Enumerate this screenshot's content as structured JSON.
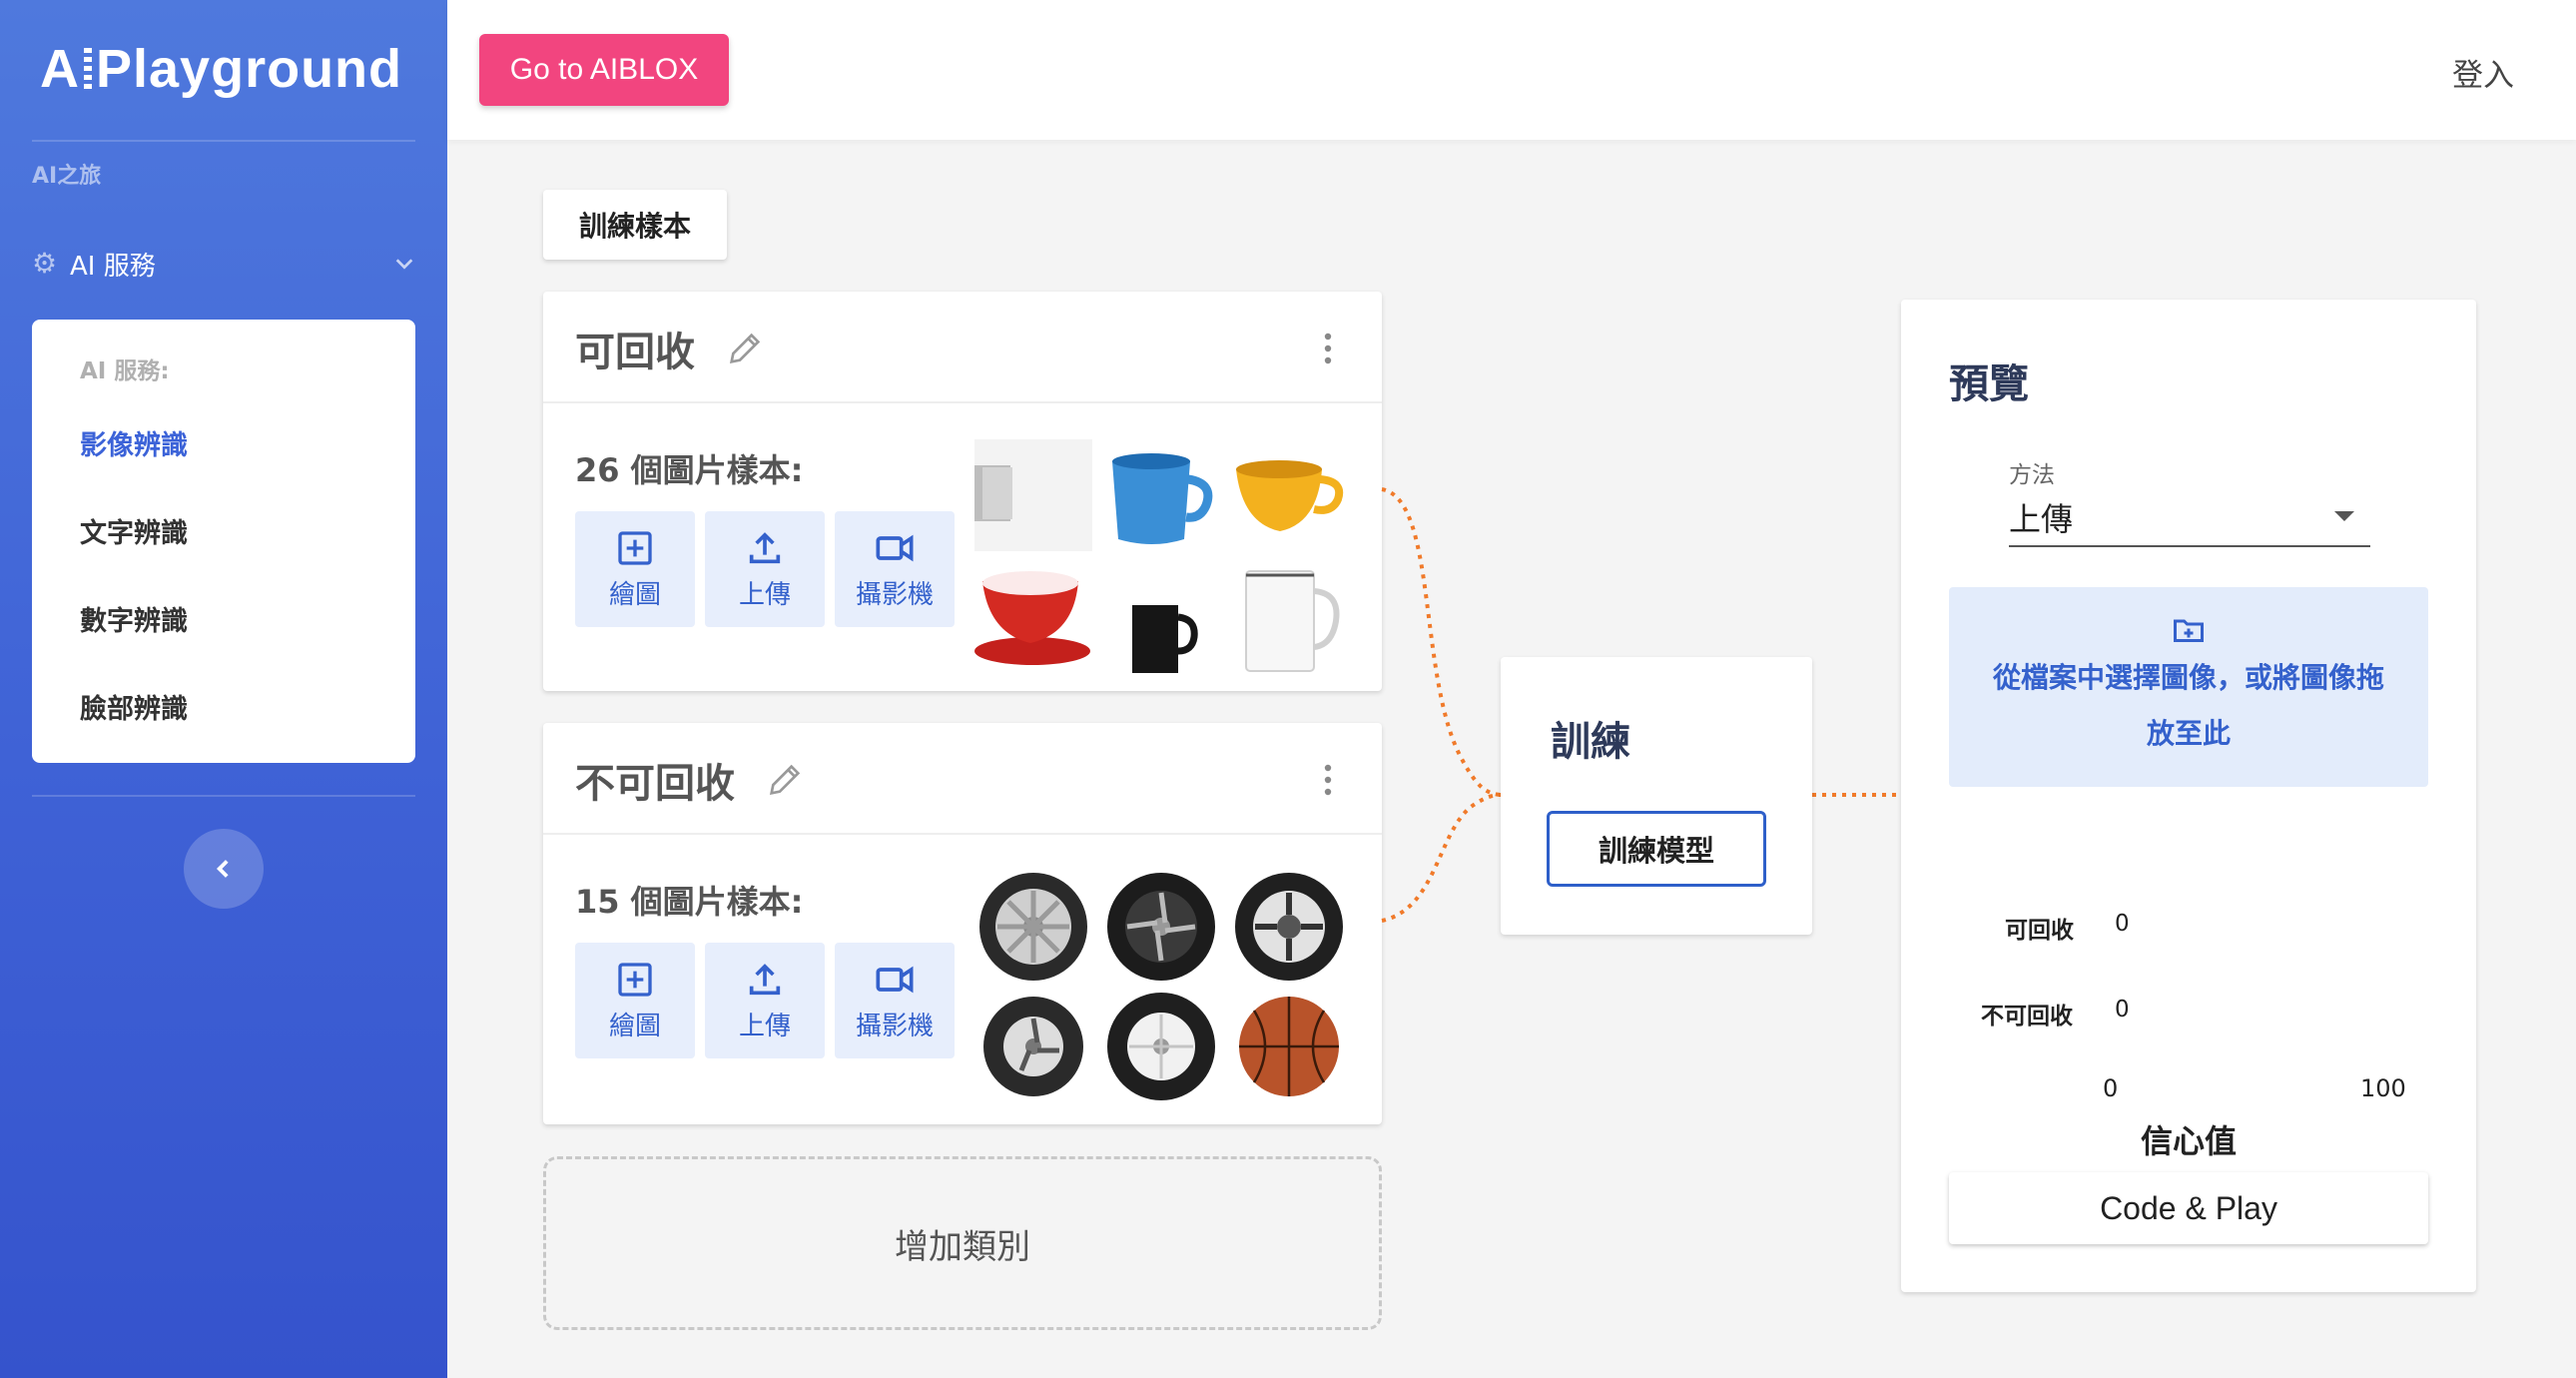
{
  "sidebar": {
    "logo_left": "A",
    "logo_right": "Playground",
    "caption": "AI之旅",
    "service_label": "AI 服務",
    "menu": {
      "caption": "AI 服務:",
      "items": [
        {
          "label": "影像辨識",
          "active": true
        },
        {
          "label": "文字辨識",
          "active": false
        },
        {
          "label": "數字辨識",
          "active": false
        },
        {
          "label": "臉部辨識",
          "active": false
        }
      ]
    },
    "collapse_icon": "chevron-left-icon"
  },
  "header": {
    "goto_label": "Go to AIBLOX",
    "goto_color": "#f2457f",
    "login_label": "登入"
  },
  "train_samples_label": "訓練樣本",
  "classes": [
    {
      "name": "可回收",
      "sample_count_text": "26 個圖片樣本:",
      "actions": [
        "繪圖",
        "上傳",
        "攝影機"
      ],
      "thumbnails": [
        "gray-mug",
        "blue-mug",
        "yellow-mug",
        "red-mug",
        "black-mug",
        "white-mug"
      ]
    },
    {
      "name": "不可回收",
      "sample_count_text": "15 個圖片樣本:",
      "actions": [
        "繪圖",
        "上傳",
        "攝影機"
      ],
      "thumbnails": [
        "tire-silver",
        "tire-black",
        "tire-chrome",
        "tire-small",
        "tire-white",
        "basketball"
      ]
    }
  ],
  "add_class_label": "增加類別",
  "train": {
    "title": "訓練",
    "button_label": "訓練模型"
  },
  "preview": {
    "title": "預覽",
    "method_label": "方法",
    "method_value": "上傳",
    "dropzone_line1": "從檔案中選擇圖像，或將圖像拖",
    "dropzone_line2": "放至此",
    "confidences": [
      {
        "label": "可回收",
        "value": "0"
      },
      {
        "label": "不可回收",
        "value": "0"
      }
    ],
    "axis_min": "0",
    "axis_max": "100",
    "confidence_label": "信心值",
    "code_play_label": "Code & Play"
  },
  "colors": {
    "accent": "#3461cc",
    "connector": "#f07a2a"
  }
}
